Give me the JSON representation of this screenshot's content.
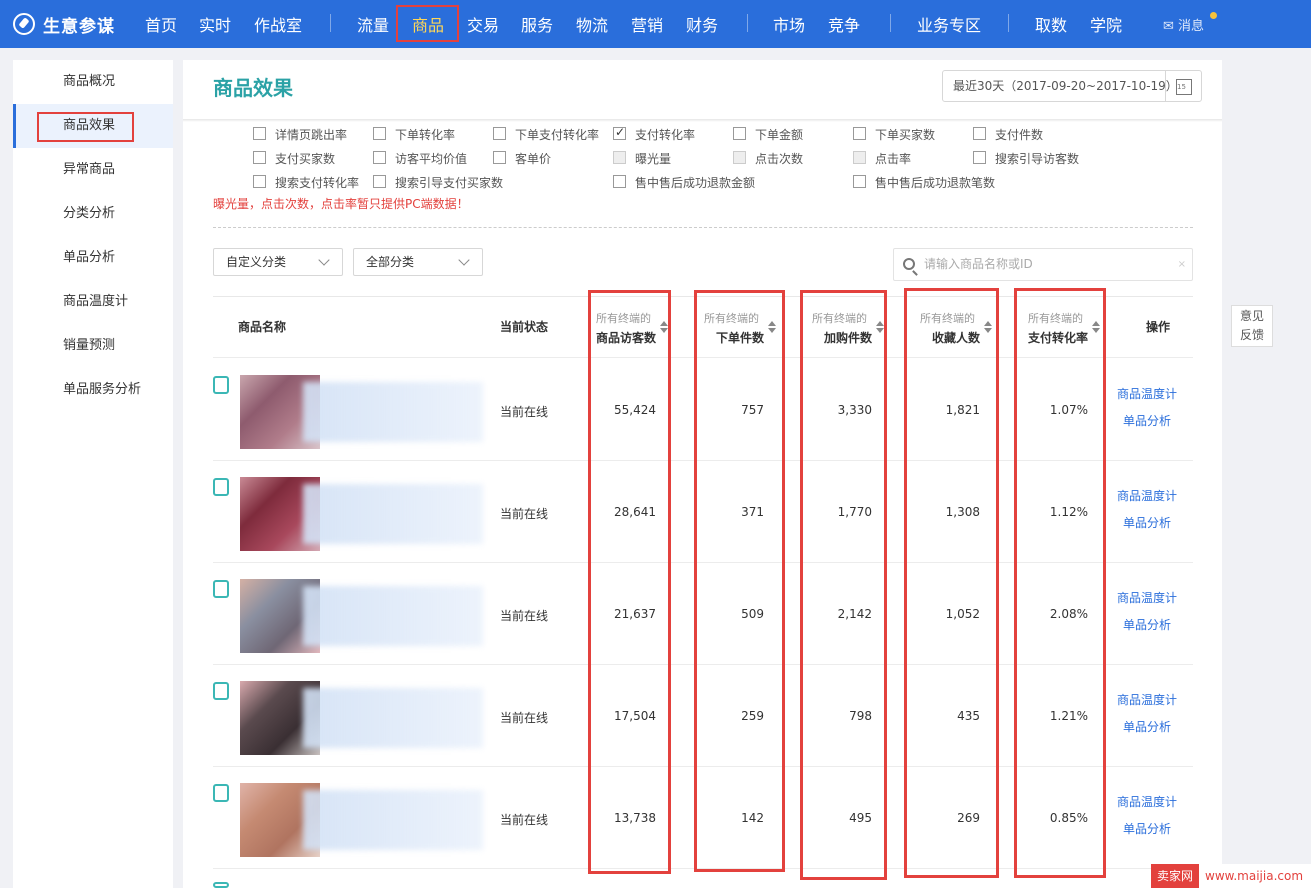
{
  "topnav": {
    "brand": "生意参谋",
    "items": [
      {
        "label": "首页"
      },
      {
        "label": "实时"
      },
      {
        "label": "作战室"
      },
      {
        "label": "流量"
      },
      {
        "label": "商品"
      },
      {
        "label": "交易"
      },
      {
        "label": "服务"
      },
      {
        "label": "物流"
      },
      {
        "label": "营销"
      },
      {
        "label": "财务"
      },
      {
        "label": "市场"
      },
      {
        "label": "竞争"
      },
      {
        "label": "业务专区"
      },
      {
        "label": "取数"
      },
      {
        "label": "学院"
      }
    ],
    "active": "商品",
    "message": "消息"
  },
  "sidebar": {
    "items": [
      {
        "label": "商品概况"
      },
      {
        "label": "商品效果"
      },
      {
        "label": "异常商品"
      },
      {
        "label": "分类分析"
      },
      {
        "label": "单品分析"
      },
      {
        "label": "商品温度计"
      },
      {
        "label": "销量预测"
      },
      {
        "label": "单品服务分析"
      }
    ],
    "active": "商品效果"
  },
  "main": {
    "title": "商品效果",
    "date_range": "最近30天（2017-09-20~2017-10-19）",
    "metrics": [
      {
        "label": "详情页跳出率",
        "checked": false
      },
      {
        "label": "下单转化率",
        "checked": false
      },
      {
        "label": "下单支付转化率",
        "checked": false
      },
      {
        "label": "支付转化率",
        "checked": true
      },
      {
        "label": "下单金额",
        "checked": false
      },
      {
        "label": "下单买家数",
        "checked": false
      },
      {
        "label": "支付件数",
        "checked": false
      },
      {
        "label": "支付买家数",
        "checked": false
      },
      {
        "label": "访客平均价值",
        "checked": false
      },
      {
        "label": "客单价",
        "checked": false
      },
      {
        "label": "曝光量",
        "checked": false,
        "disabled": true
      },
      {
        "label": "点击次数",
        "checked": false,
        "disabled": true
      },
      {
        "label": "点击率",
        "checked": false,
        "disabled": true
      },
      {
        "label": "搜索引导访客数",
        "checked": false
      },
      {
        "label": "搜索支付转化率",
        "checked": false
      },
      {
        "label": "搜索引导支付买家数",
        "checked": false
      },
      {
        "label": "售中售后成功退款金额",
        "checked": false
      },
      {
        "label": "售中售后成功退款笔数",
        "checked": false
      }
    ],
    "warning": "曝光量，点击次数，点击率暂只提供PC端数据！",
    "filters": {
      "category_custom": "自定义分类",
      "category_all": "全部分类"
    },
    "search": {
      "placeholder": "请输入商品名称或ID",
      "clear": "×"
    },
    "table": {
      "headers": {
        "name": "商品名称",
        "status": "当前状态",
        "visitors": {
          "sub": "所有终端的",
          "main": "商品访客数"
        },
        "orders": {
          "sub": "所有终端的",
          "main": "下单件数"
        },
        "cart": {
          "sub": "所有终端的",
          "main": "加购件数"
        },
        "favorites": {
          "sub": "所有终端的",
          "main": "收藏人数"
        },
        "pay_rate": {
          "sub": "所有终端的",
          "main": "支付转化率"
        },
        "actions": "操作"
      },
      "rows": [
        {
          "status": "当前在线",
          "visitors": "55,424",
          "orders": "757",
          "cart": "3,330",
          "favorites": "1,821",
          "pay_rate": "1.07%"
        },
        {
          "status": "当前在线",
          "visitors": "28,641",
          "orders": "371",
          "cart": "1,770",
          "favorites": "1,308",
          "pay_rate": "1.12%"
        },
        {
          "status": "当前在线",
          "visitors": "21,637",
          "orders": "509",
          "cart": "2,142",
          "favorites": "1,052",
          "pay_rate": "2.08%"
        },
        {
          "status": "当前在线",
          "visitors": "17,504",
          "orders": "259",
          "cart": "798",
          "favorites": "435",
          "pay_rate": "1.21%"
        },
        {
          "status": "当前在线",
          "visitors": "13,738",
          "orders": "142",
          "cart": "495",
          "favorites": "269",
          "pay_rate": "0.85%"
        }
      ],
      "action_links": {
        "thermometer": "商品温度计",
        "analysis": "单品分析"
      }
    }
  },
  "feedback": {
    "line1": "意见",
    "line2": "反馈"
  },
  "watermark": {
    "site": "卖家网",
    "url": "www.maijia.com"
  },
  "colors": {
    "nav_bg": "#2a6edb",
    "accent": "#2ba2a6",
    "highlight": "#e3413d",
    "link": "#2a6edb"
  }
}
